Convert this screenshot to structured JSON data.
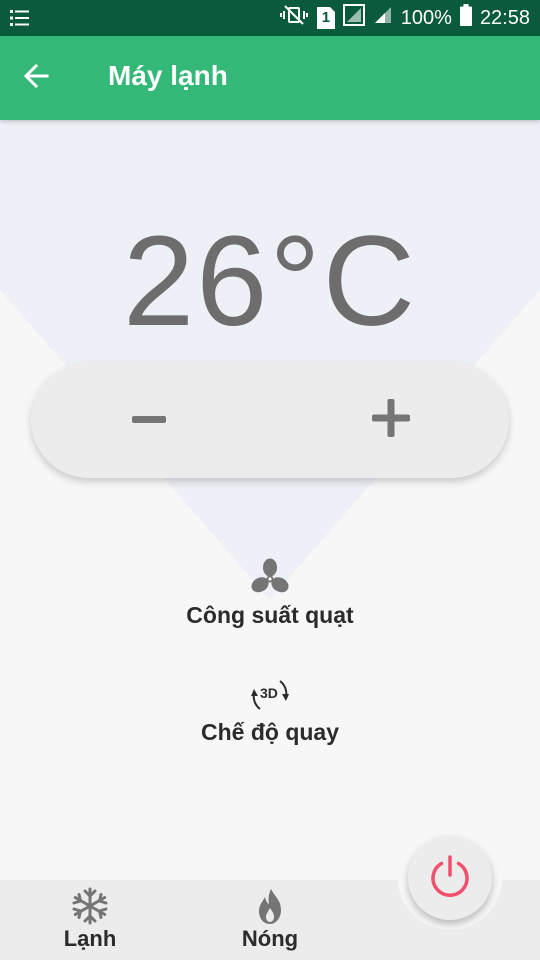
{
  "status_bar": {
    "battery": "100%",
    "time": "22:58",
    "sim_slot": "1"
  },
  "app_bar": {
    "title": "Máy lạnh",
    "back_icon": "arrow-left-icon"
  },
  "thermostat": {
    "temperature": "26°C",
    "decrease_icon": "minus-icon",
    "increase_icon": "plus-icon"
  },
  "features": {
    "fan": {
      "label": "Công suất quạt",
      "icon": "fan-icon"
    },
    "swing": {
      "label": "Chế độ quay",
      "icon": "rotate-3d-icon",
      "icon_text": "3D"
    }
  },
  "bottom_nav": {
    "cold": {
      "label": "Lạnh",
      "icon": "snowflake-icon"
    },
    "hot": {
      "label": "Nóng",
      "icon": "flame-icon"
    },
    "power": {
      "icon": "power-icon"
    }
  },
  "colors": {
    "status_bar": "#0a5a3c",
    "app_bar": "#34b877",
    "temperature_text": "#6d6d6d",
    "power_accent": "#f0506e",
    "icon_gray": "#757575",
    "background_triangle": "#edf1f7"
  }
}
